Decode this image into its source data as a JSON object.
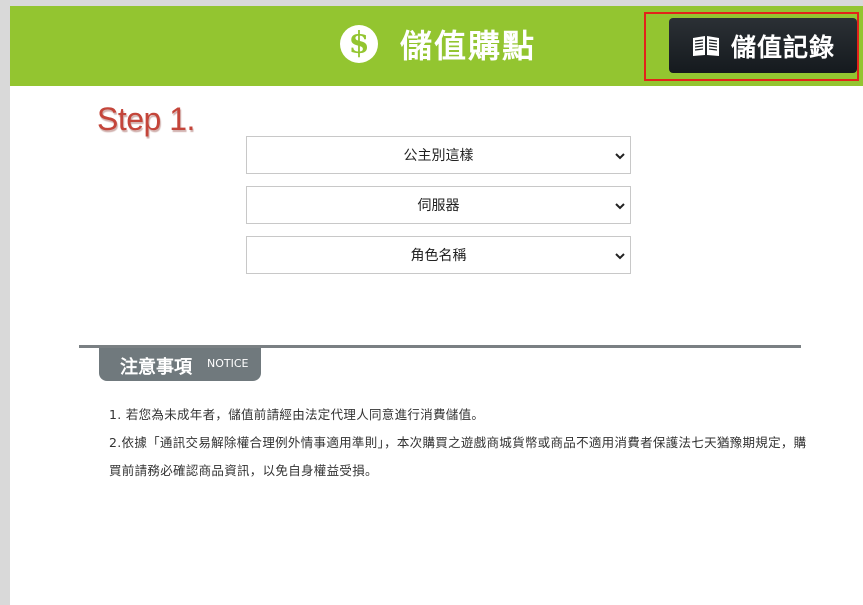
{
  "header": {
    "title": "儲值購點",
    "logo_glyph": "$",
    "record_button_label": "儲值記錄",
    "record_icon": "book-icon",
    "bar_color": "#93c530",
    "highlight_color": "#e2231a"
  },
  "step": {
    "label": "Step 1."
  },
  "selects": {
    "game": {
      "value": "公主別這樣"
    },
    "server": {
      "value": "伺服器"
    },
    "character": {
      "value": "角色名稱"
    }
  },
  "notice": {
    "title": "注意事項",
    "title_en": "NOTICE",
    "items": [
      "1. 若您為未成年者，儲值前請經由法定代理人同意進行消費儲值。",
      "2.依據「通訊交易解除權合理例外情事適用準則」，本次購買之遊戲商城貨幣或商品不適用消費者保護法七天猶豫期規定，購買前請務必確認商品資訊，以免自身權益受損。"
    ]
  }
}
